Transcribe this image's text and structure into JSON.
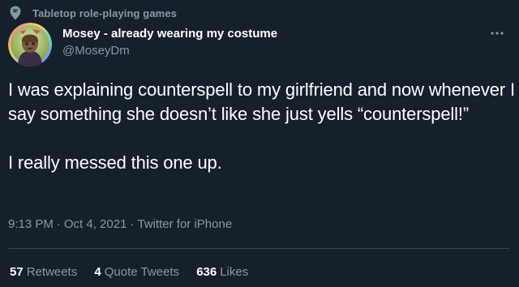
{
  "context": {
    "icon": "location-pin-icon",
    "label": "Tabletop role-playing games"
  },
  "author": {
    "display_name": "Mosey - already wearing my costume",
    "handle": "@MoseyDm",
    "avatar": "avatar-image"
  },
  "tweet": {
    "text": "I was explaining counterspell to my girlfriend and now whenever I say something she doesn’t like she just yells “counterspell!”\n\nI really messed this one up.",
    "time": "9:13 PM",
    "date": "Oct 4, 2021",
    "source": "Twitter for iPhone",
    "separator": "·"
  },
  "stats": [
    {
      "count": "57",
      "label": "Retweets"
    },
    {
      "count": "4",
      "label": "Quote Tweets"
    },
    {
      "count": "636",
      "label": "Likes"
    }
  ],
  "menu": {
    "icon": "more-options-icon"
  },
  "colors": {
    "background": "#15202b",
    "secondary_text": "#8899a6",
    "divider": "#38444d",
    "primary_text": "#ffffff"
  }
}
